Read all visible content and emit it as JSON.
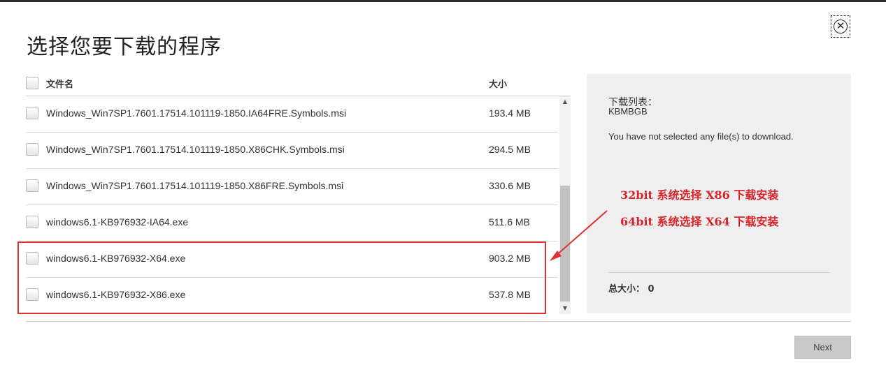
{
  "dialog": {
    "title": "选择您要下载的程序",
    "close_glyph": "✕"
  },
  "table": {
    "header_name": "文件名",
    "header_size": "大小",
    "rows": [
      {
        "name": "Windows_Win7SP1.7601.17514.101119-1850.IA64FRE.Symbols.msi",
        "size": "193.4 MB"
      },
      {
        "name": "Windows_Win7SP1.7601.17514.101119-1850.X86CHK.Symbols.msi",
        "size": "294.5 MB"
      },
      {
        "name": "Windows_Win7SP1.7601.17514.101119-1850.X86FRE.Symbols.msi",
        "size": "330.6 MB"
      },
      {
        "name": "windows6.1-KB976932-IA64.exe",
        "size": "511.6 MB"
      },
      {
        "name": "windows6.1-KB976932-X64.exe",
        "size": "903.2 MB"
      },
      {
        "name": "windows6.1-KB976932-X86.exe",
        "size": "537.8 MB"
      }
    ]
  },
  "scrollbar": {
    "up_glyph": "▲",
    "down_glyph": "▼"
  },
  "panel": {
    "list_label": "下载列表：",
    "list_unit": "KBMBGB",
    "empty_message": "You have not selected any file(s) to download.",
    "total_label": "总大小：",
    "total_value": "0"
  },
  "annotations": {
    "line1": "32bit 系统选择 X86 下载安装",
    "line2": "64bit 系统选择 X64 下载安装",
    "color": "#d9232b"
  },
  "footer": {
    "next_label": "Next"
  }
}
